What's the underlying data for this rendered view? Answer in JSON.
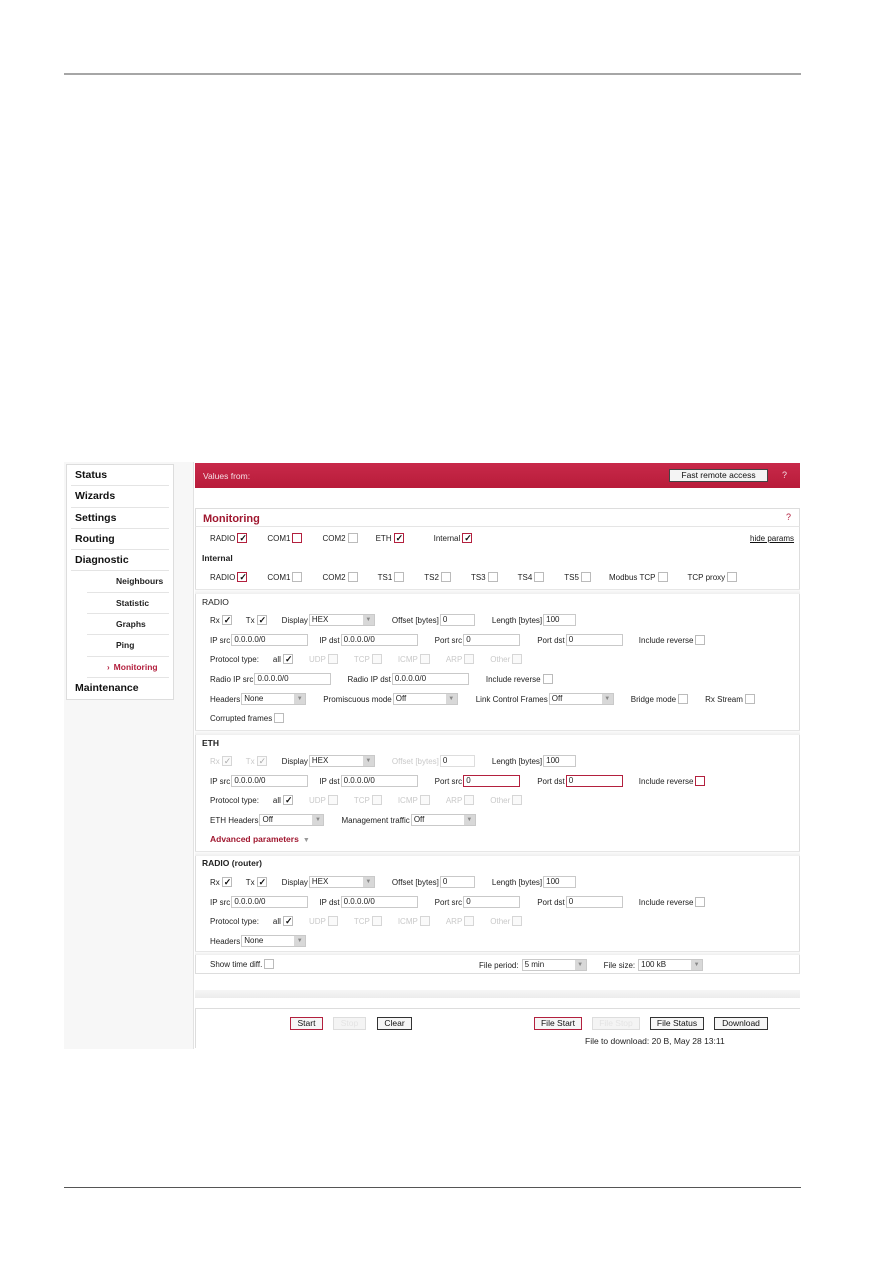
{
  "sidebar": {
    "items": [
      {
        "label": "Status"
      },
      {
        "label": "Wizards"
      },
      {
        "label": "Settings"
      },
      {
        "label": "Routing"
      },
      {
        "label": "Diagnostic"
      },
      {
        "label": "Neighbours"
      },
      {
        "label": "Statistic"
      },
      {
        "label": "Graphs"
      },
      {
        "label": "Ping"
      },
      {
        "label": "Monitoring",
        "active": true,
        "marker": "›"
      },
      {
        "label": "Maintenance"
      }
    ]
  },
  "topbar": {
    "label": "Values from:",
    "fast_remote_access": "Fast remote access",
    "help": "?"
  },
  "monitoring": {
    "title": "Monitoring",
    "help": "?",
    "sources": [
      {
        "label": "RADIO",
        "checked": true
      },
      {
        "label": "COM1",
        "checked": false
      },
      {
        "label": "COM2",
        "checked": false
      },
      {
        "label": "ETH",
        "checked": true
      },
      {
        "label": "Internal",
        "checked": true
      }
    ],
    "hide_params": "hide params",
    "internal": {
      "title": "Internal",
      "items": [
        {
          "label": "RADIO",
          "checked": true
        },
        {
          "label": "COM1",
          "checked": false
        },
        {
          "label": "COM2",
          "checked": false
        },
        {
          "label": "TS1",
          "checked": false
        },
        {
          "label": "TS2",
          "checked": false
        },
        {
          "label": "TS3",
          "checked": false
        },
        {
          "label": "TS4",
          "checked": false
        },
        {
          "label": "TS5",
          "checked": false
        },
        {
          "label": "Modbus TCP",
          "checked": false
        },
        {
          "label": "TCP proxy",
          "checked": false
        }
      ]
    }
  },
  "labels": {
    "rx": "Rx",
    "tx": "Tx",
    "display": "Display",
    "offset": "Offset [bytes]",
    "length": "Length [bytes]",
    "ip_src": "IP src",
    "ip_dst": "IP dst",
    "port_src": "Port src",
    "port_dst": "Port dst",
    "include_reverse": "Include reverse",
    "protocol_type": "Protocol type:",
    "all": "all",
    "udp": "UDP",
    "tcp": "TCP",
    "icmp": "ICMP",
    "arp": "ARP",
    "other": "Other",
    "radio_ip_src": "Radio IP src",
    "radio_ip_dst": "Radio IP dst",
    "include_reverse_lc": "Include reverse",
    "headers": "Headers",
    "promiscuous": "Promiscuous mode",
    "link_control": "Link Control Frames",
    "bridge_mode": "Bridge mode",
    "rx_stream": "Rx Stream",
    "corrupted": "Corrupted frames",
    "eth_headers": "ETH Headers",
    "mgmt_traffic": "Management traffic",
    "advanced": "Advanced parameters"
  },
  "radio": {
    "title": "RADIO",
    "display": "HEX",
    "offset": "0",
    "length": "100",
    "ip_src": "0.0.0.0/0",
    "ip_dst": "0.0.0.0/0",
    "port_src": "0",
    "port_dst": "0",
    "radio_ip_src": "0.0.0.0/0",
    "radio_ip_dst": "0.0.0.0/0",
    "headers": "None",
    "promiscuous": "Off",
    "link_control": "Off"
  },
  "eth": {
    "title": "ETH",
    "display": "HEX",
    "offset": "0",
    "length": "100",
    "ip_src": "0.0.0.0/0",
    "ip_dst": "0.0.0.0/0",
    "port_src": "0",
    "port_dst": "0",
    "eth_headers": "Off",
    "mgmt_traffic": "Off"
  },
  "radio_router": {
    "title": "RADIO (router)",
    "display": "HEX",
    "offset": "0",
    "length": "100",
    "ip_src": "0.0.0.0/0",
    "ip_dst": "0.0.0.0/0",
    "port_src": "0",
    "port_dst": "0",
    "headers": "None"
  },
  "options": {
    "show_time_diff": "Show time diff.",
    "file_period_label": "File period:",
    "file_period": "5 min",
    "file_size_label": "File size:",
    "file_size": "100 kB"
  },
  "actions": {
    "start": "Start",
    "stop": "Stop",
    "clear": "Clear",
    "file_start": "File Start",
    "file_stop": "File Stop",
    "file_status": "File Status",
    "download": "Download",
    "file_to_download": "File to download: 20 B, May 28 13:11"
  },
  "colors": {
    "accent": "#c0213f",
    "title": "#a0172f"
  }
}
